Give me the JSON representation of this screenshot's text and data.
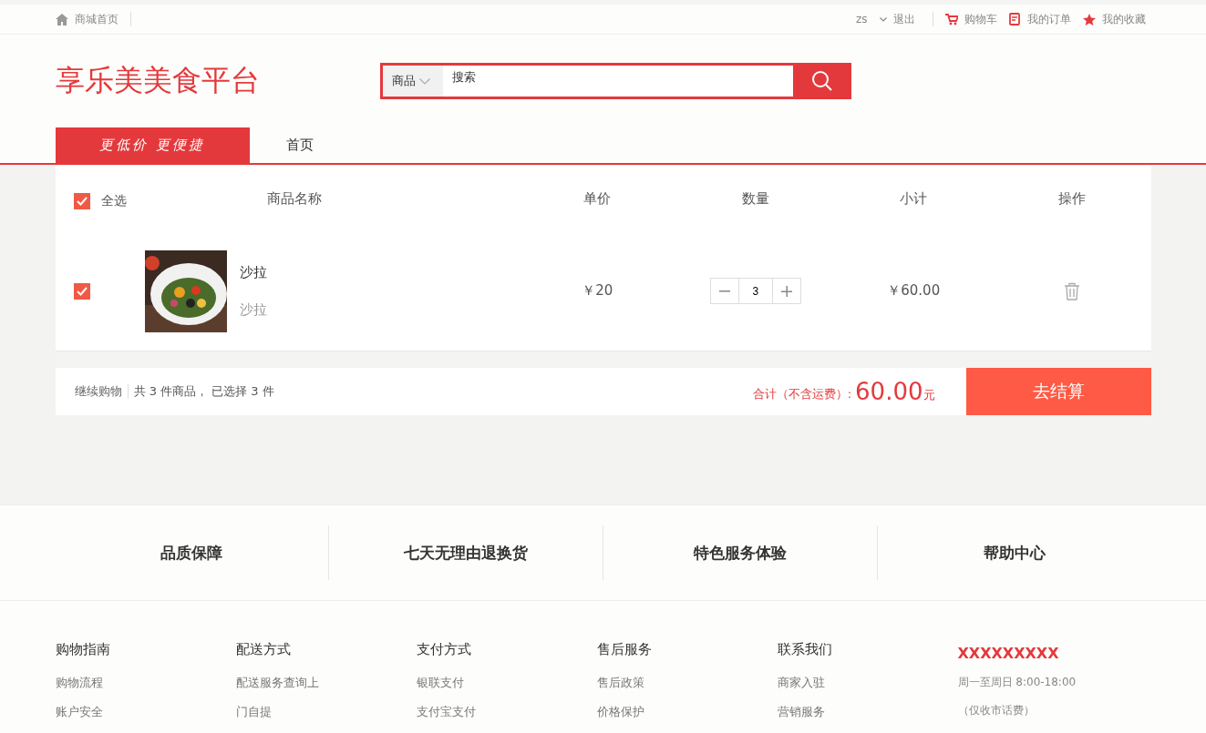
{
  "topbar": {
    "home": "商城首页",
    "user": "zs",
    "logout": "退出",
    "links": [
      {
        "label": "购物车",
        "kind": "cart"
      },
      {
        "label": "我的订单",
        "kind": "order"
      },
      {
        "label": "我的收藏",
        "kind": "star"
      }
    ]
  },
  "header": {
    "logo": "享乐美美食平台",
    "search": {
      "category": "商品",
      "placeholder": "搜索"
    }
  },
  "nav": [
    {
      "label": "更低价 更便捷",
      "selected": true
    },
    {
      "label": "首页",
      "selected": false
    }
  ],
  "cart": {
    "select_all": {
      "label": "全选",
      "checked": true
    },
    "columns": [
      "商品名称",
      "单价",
      "数量",
      "小计",
      "操作"
    ],
    "items": [
      {
        "checked": true,
        "name": "沙拉",
        "subtitle": "沙拉",
        "price": "￥20",
        "quantity": "3",
        "subtotal": "￥60.00"
      }
    ],
    "summary": {
      "continue": "继续购物",
      "count": "共 3 件商品， 已选择 3 件",
      "total_label": "合计（不含运费）:",
      "total": "60.00",
      "unit": "元",
      "checkout": "去结算"
    }
  },
  "services": [
    "品质保障",
    "七天无理由退换货",
    "特色服务体验",
    "帮助中心"
  ],
  "footer": {
    "columns": [
      {
        "title": "购物指南",
        "links": [
          "购物流程",
          "账户安全"
        ]
      },
      {
        "title": "配送方式",
        "links": [
          "配送服务查询上",
          "门自提"
        ]
      },
      {
        "title": "支付方式",
        "links": [
          "银联支付",
          "支付宝支付"
        ]
      },
      {
        "title": "售后服务",
        "links": [
          "售后政策",
          "价格保护"
        ]
      },
      {
        "title": "联系我们",
        "links": [
          "商家入驻",
          "营销服务"
        ]
      }
    ],
    "contact": {
      "phone": "XXXXXXXXX",
      "hours": "周一至周日 8:00-18:00",
      "note": "（仅收市话费）"
    }
  }
}
